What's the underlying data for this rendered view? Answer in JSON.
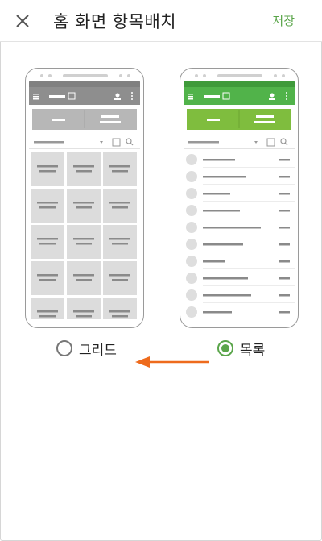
{
  "header": {
    "title": "홈 화면 항목배치",
    "save_label": "저장"
  },
  "options": [
    {
      "label": "그리드",
      "selected": false
    },
    {
      "label": "목록",
      "selected": true
    }
  ],
  "colors": {
    "accent": "#5aa54a",
    "arrow": "#ee6b1d",
    "grid_preview_bar": "#8e8e8e",
    "list_preview_bar": "#51b34a"
  },
  "icons": {
    "close": "close-icon"
  }
}
